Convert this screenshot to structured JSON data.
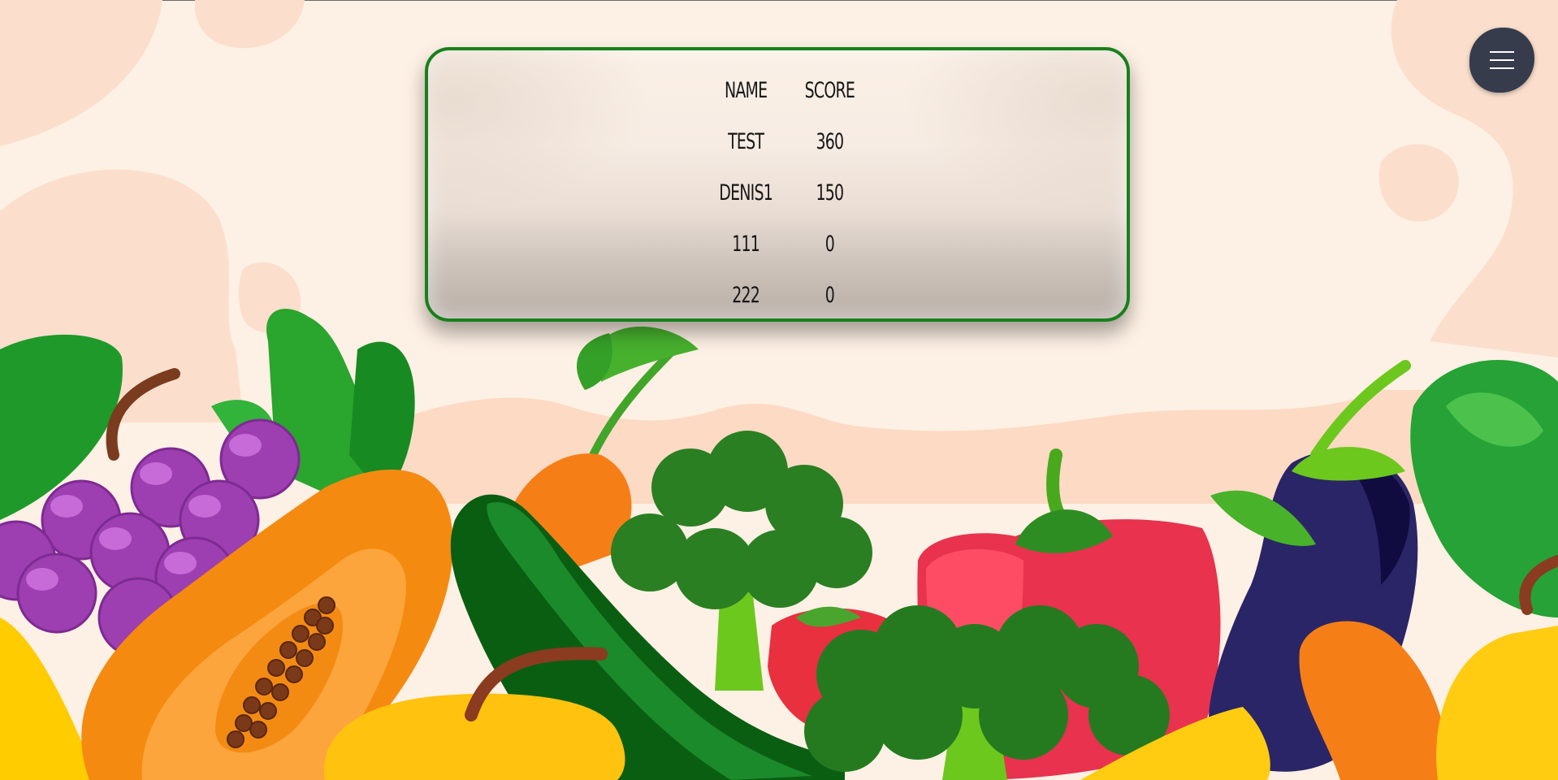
{
  "scoreboard": {
    "headers": {
      "name": "NAME",
      "score": "SCORE"
    },
    "rows": [
      {
        "name": "TEST",
        "score": "360"
      },
      {
        "name": "DENIS1",
        "score": "150"
      },
      {
        "name": "111",
        "score": "0"
      },
      {
        "name": "222",
        "score": "0"
      }
    ]
  },
  "menu": {
    "icon": "hamburger-menu-icon"
  },
  "colors": {
    "background": "#fdf0e4",
    "board_border": "#17801c",
    "menu_button": "#363c4c",
    "text": "#161616"
  }
}
